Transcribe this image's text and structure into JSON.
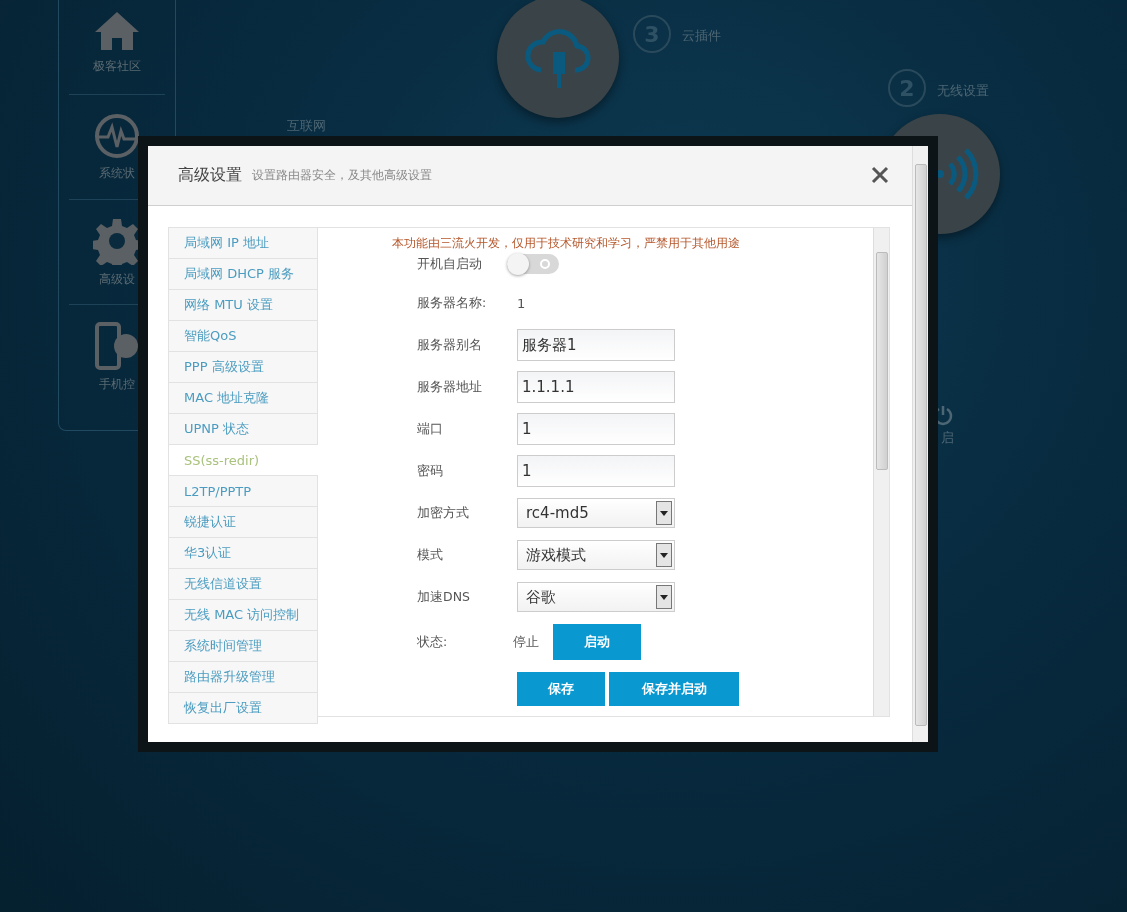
{
  "background": {
    "nav": [
      {
        "label": "极客社区"
      },
      {
        "label": "系统状"
      },
      {
        "label": "高级设"
      },
      {
        "label": "手机控"
      }
    ],
    "steps": [
      {
        "number": "3",
        "label": "云插件"
      },
      {
        "number": "2",
        "label": "无线设置"
      }
    ],
    "internet_label": "互联网",
    "reboot_label": "启"
  },
  "dialog": {
    "title": "高级设置",
    "subtitle": "设置路由器安全，及其他高级设置",
    "menu": [
      {
        "label": "局域网 IP 地址",
        "selected": false
      },
      {
        "label": "局域网 DHCP 服务",
        "selected": false
      },
      {
        "label": "网络 MTU 设置",
        "selected": false
      },
      {
        "label": "智能QoS",
        "selected": false
      },
      {
        "label": "PPP 高级设置",
        "selected": false
      },
      {
        "label": "MAC 地址克隆",
        "selected": false
      },
      {
        "label": "UPNP 状态",
        "selected": false
      },
      {
        "label": "SS(ss-redir)",
        "selected": true
      },
      {
        "label": "L2TP/PPTP",
        "selected": false
      },
      {
        "label": "锐捷认证",
        "selected": false
      },
      {
        "label": "华3认证",
        "selected": false
      },
      {
        "label": "无线信道设置",
        "selected": false
      },
      {
        "label": "无线 MAC 访问控制",
        "selected": false
      },
      {
        "label": "系统时间管理",
        "selected": false
      },
      {
        "label": "路由器升级管理",
        "selected": false
      },
      {
        "label": "恢复出厂设置",
        "selected": false
      }
    ],
    "notice": "本功能由三流火开发，仅用于技术研究和学习，严禁用于其他用途",
    "fields": [
      {
        "kind": "toggle",
        "label": "开机自启动",
        "on": false
      },
      {
        "kind": "text",
        "label": "服务器名称:",
        "value": "1"
      },
      {
        "kind": "input",
        "label": "服务器别名",
        "value": "服务器1"
      },
      {
        "kind": "input",
        "label": "服务器地址",
        "value": "1.1.1.1"
      },
      {
        "kind": "input",
        "label": "端口",
        "value": "1"
      },
      {
        "kind": "input",
        "label": "密码",
        "value": "1"
      },
      {
        "kind": "select",
        "label": "加密方式",
        "value": "rc4-md5"
      },
      {
        "kind": "select",
        "label": "模式",
        "value": "游戏模式"
      },
      {
        "kind": "select",
        "label": "加速DNS",
        "value": "谷歌"
      },
      {
        "kind": "status",
        "label": "状态:",
        "value": "停止",
        "button": "启动"
      }
    ],
    "buttons": [
      "保存",
      "保存并启动"
    ]
  }
}
